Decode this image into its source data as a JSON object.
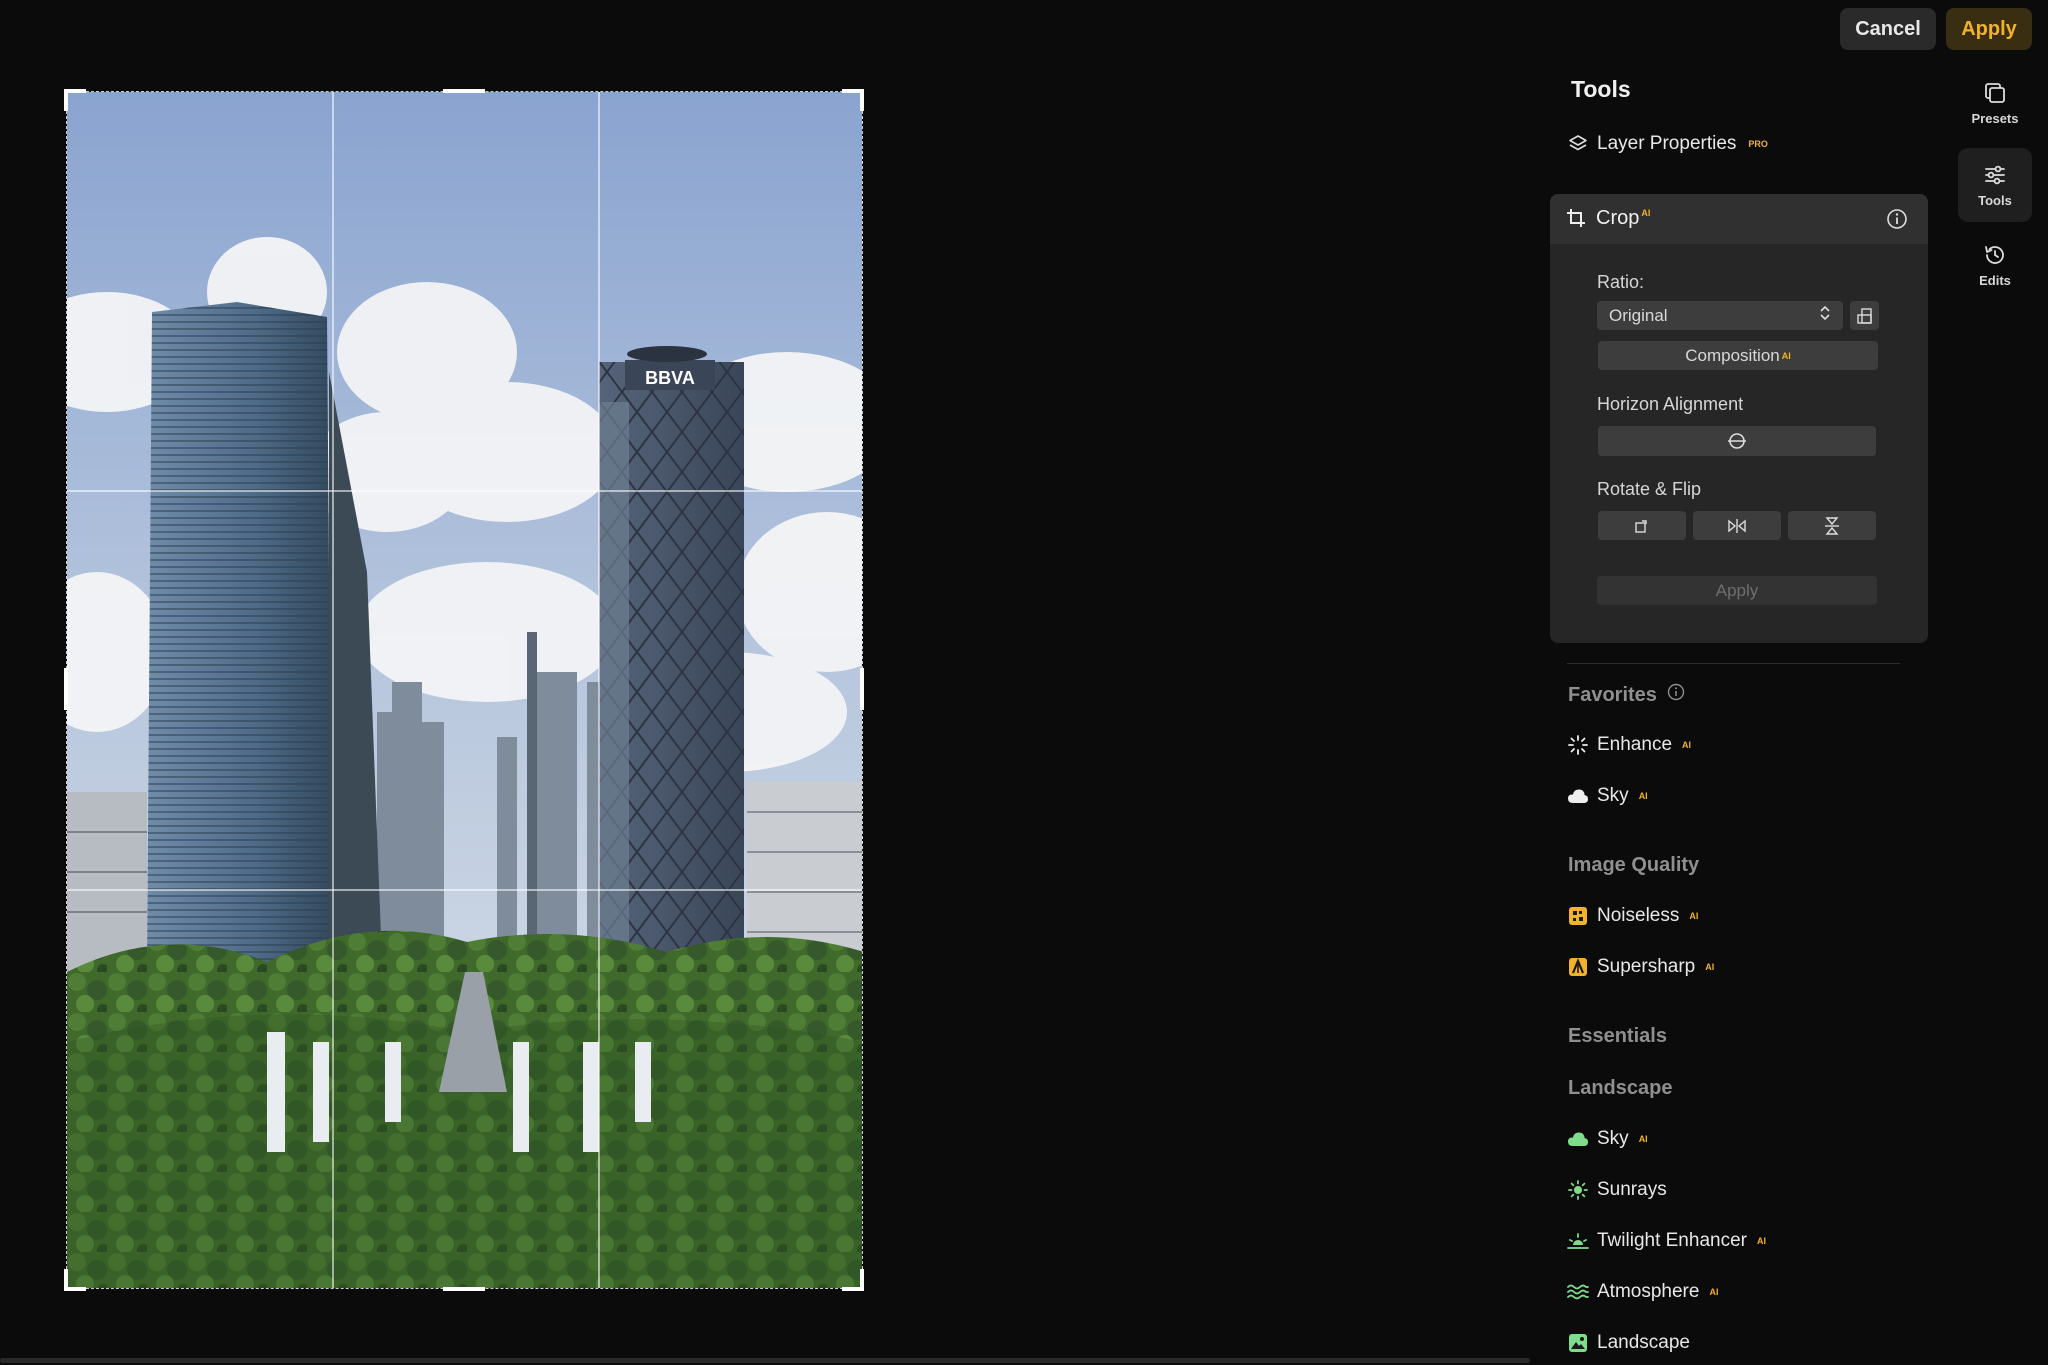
{
  "header": {
    "cancel_label": "Cancel",
    "apply_label": "Apply"
  },
  "rail": [
    {
      "label": "Presets"
    },
    {
      "label": "Tools"
    },
    {
      "label": "Edits"
    }
  ],
  "panel": {
    "title": "Tools",
    "layer_properties": {
      "label": "Layer Properties",
      "badge": "PRO"
    },
    "crop": {
      "title": "Crop",
      "badge": "AI",
      "ratio_label": "Ratio:",
      "ratio_value": "Original",
      "composition_label": "Composition",
      "composition_badge": "AI",
      "horizon_label": "Horizon Alignment",
      "rotate_flip_label": "Rotate & Flip",
      "apply_label": "Apply"
    },
    "favorites": {
      "title": "Favorites",
      "items": [
        {
          "label": "Enhance",
          "badge": "AI"
        },
        {
          "label": "Sky",
          "badge": "AI"
        }
      ]
    },
    "image_quality": {
      "title": "Image Quality",
      "items": [
        {
          "label": "Noiseless",
          "badge": "AI"
        },
        {
          "label": "Supersharp",
          "badge": "AI"
        }
      ]
    },
    "essentials": {
      "title": "Essentials"
    },
    "landscape": {
      "title": "Landscape",
      "items": [
        {
          "label": "Sky",
          "badge": "AI"
        },
        {
          "label": "Sunrays",
          "badge": ""
        },
        {
          "label": "Twilight Enhancer",
          "badge": "AI"
        },
        {
          "label": "Atmosphere",
          "badge": "AI"
        },
        {
          "label": "Landscape",
          "badge": ""
        }
      ]
    }
  },
  "photo": {
    "sign_text": "BBVA"
  }
}
